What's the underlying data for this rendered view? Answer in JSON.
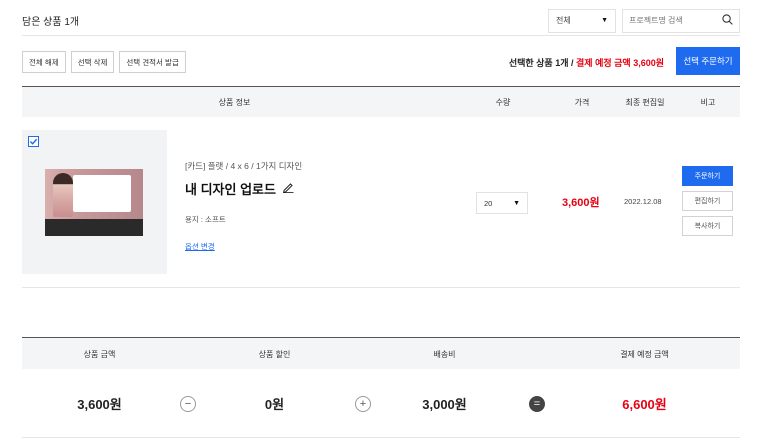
{
  "header": {
    "cart_count_label": "담은 상품 1개",
    "filter_value": "전체",
    "search_placeholder": "프로젝트명 검색"
  },
  "actions": {
    "deselect_all": "전체 해제",
    "delete_selected": "선택 삭제",
    "quote_selected": "선택 견적서 발급",
    "summary_prefix": "선택한 상품 1개 / ",
    "summary_amount": "결제 예정 금액 3,600원",
    "order_selected": "선택 주문하기"
  },
  "table": {
    "headers": {
      "product_info": "상품 정보",
      "quantity": "수량",
      "price": "가격",
      "last_edited": "최종 편집일",
      "note": "비고"
    }
  },
  "item": {
    "checked": true,
    "category": "[카드] 플랫 / 4 x 6 / 1가지 디자인",
    "title": "내 디자인 업로드",
    "paper": "용지 : 소프트",
    "option_change": "옵션 변경",
    "quantity": "20",
    "price": "3,600원",
    "edit_date": "2022.12.08",
    "btn_order": "주문하기",
    "btn_edit": "편집하기",
    "btn_copy": "복사하기"
  },
  "totals": {
    "headers": {
      "product_amount": "상품 금액",
      "product_discount": "상품 할인",
      "shipping": "배송비",
      "payment_amount": "결제 예정 금액"
    },
    "values": {
      "product_amount": "3,600원",
      "product_discount": "0원",
      "shipping": "3,000원",
      "payment_amount": "6,600원"
    },
    "operators": {
      "minus": "−",
      "plus": "+",
      "equals": "="
    }
  },
  "colors": {
    "accent": "#1e6bf0",
    "price_red": "#e60012",
    "header_bg": "#f4f5f7"
  },
  "icons": {
    "search": "search-icon",
    "dropdown": "triangle-down-icon",
    "edit": "pencil-icon",
    "check": "check-icon"
  }
}
